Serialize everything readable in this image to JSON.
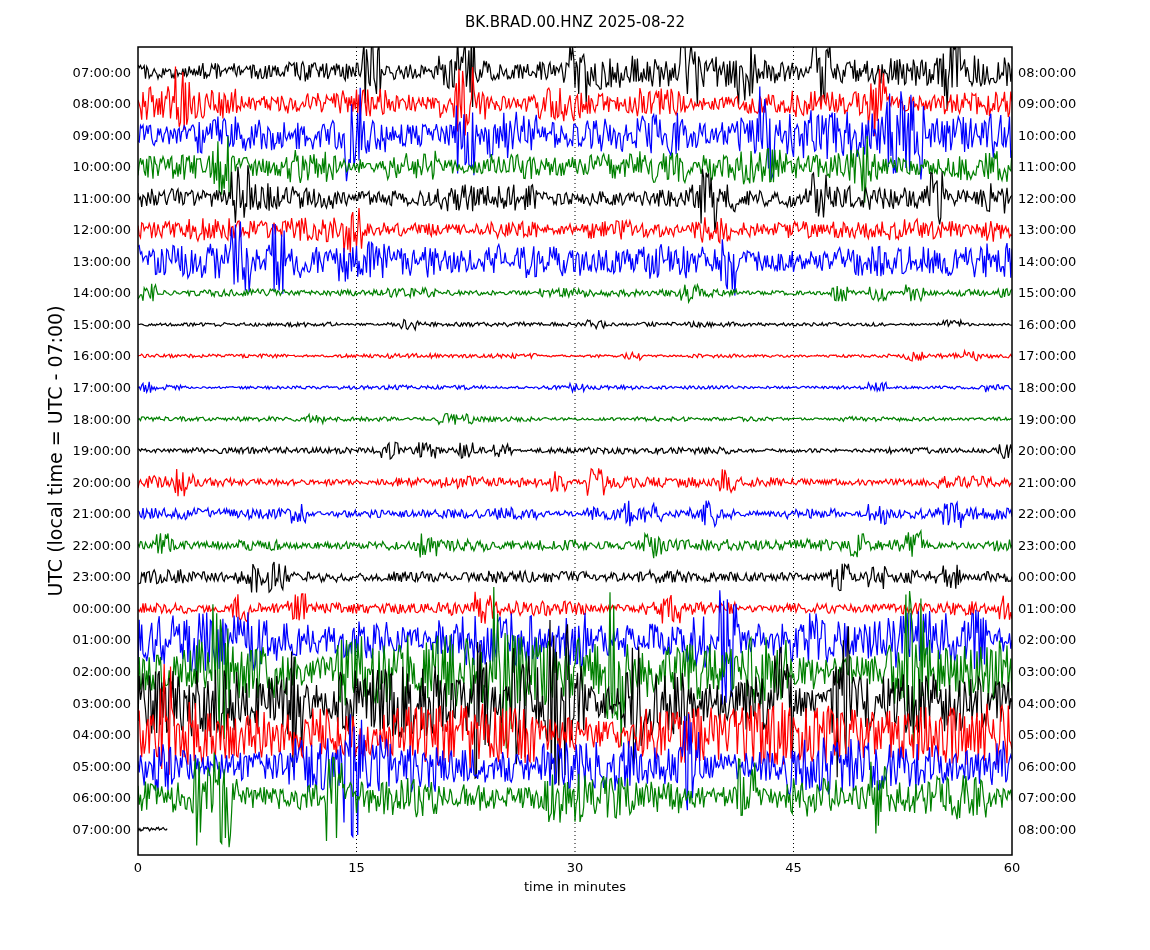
{
  "title": "BK.BRAD.00.HNZ 2025-08-22",
  "ylabel": "UTC (local time = UTC - 07:00)",
  "xlabel": "time in minutes",
  "xticks": [
    "0",
    "15",
    "30",
    "45",
    "60"
  ],
  "rows": [
    {
      "left": "07:00:00",
      "right": "08:00:00",
      "color": "#000000"
    },
    {
      "left": "08:00:00",
      "right": "09:00:00",
      "color": "#ff0000"
    },
    {
      "left": "09:00:00",
      "right": "10:00:00",
      "color": "#0000ff"
    },
    {
      "left": "10:00:00",
      "right": "11:00:00",
      "color": "#008000"
    },
    {
      "left": "11:00:00",
      "right": "12:00:00",
      "color": "#000000"
    },
    {
      "left": "12:00:00",
      "right": "13:00:00",
      "color": "#ff0000"
    },
    {
      "left": "13:00:00",
      "right": "14:00:00",
      "color": "#0000ff"
    },
    {
      "left": "14:00:00",
      "right": "15:00:00",
      "color": "#008000"
    },
    {
      "left": "15:00:00",
      "right": "16:00:00",
      "color": "#000000"
    },
    {
      "left": "16:00:00",
      "right": "17:00:00",
      "color": "#ff0000"
    },
    {
      "left": "17:00:00",
      "right": "18:00:00",
      "color": "#0000ff"
    },
    {
      "left": "18:00:00",
      "right": "19:00:00",
      "color": "#008000"
    },
    {
      "left": "19:00:00",
      "right": "20:00:00",
      "color": "#000000"
    },
    {
      "left": "20:00:00",
      "right": "21:00:00",
      "color": "#ff0000"
    },
    {
      "left": "21:00:00",
      "right": "22:00:00",
      "color": "#0000ff"
    },
    {
      "left": "22:00:00",
      "right": "23:00:00",
      "color": "#008000"
    },
    {
      "left": "23:00:00",
      "right": "00:00:00",
      "color": "#000000"
    },
    {
      "left": "00:00:00",
      "right": "01:00:00",
      "color": "#ff0000"
    },
    {
      "left": "01:00:00",
      "right": "02:00:00",
      "color": "#0000ff"
    },
    {
      "left": "02:00:00",
      "right": "03:00:00",
      "color": "#008000"
    },
    {
      "left": "03:00:00",
      "right": "04:00:00",
      "color": "#000000"
    },
    {
      "left": "04:00:00",
      "right": "05:00:00",
      "color": "#ff0000"
    },
    {
      "left": "05:00:00",
      "right": "06:00:00",
      "color": "#0000ff"
    },
    {
      "left": "06:00:00",
      "right": "07:00:00",
      "color": "#008000"
    },
    {
      "left": "07:00:00",
      "right": "08:00:00",
      "color": "#000000"
    }
  ]
}
